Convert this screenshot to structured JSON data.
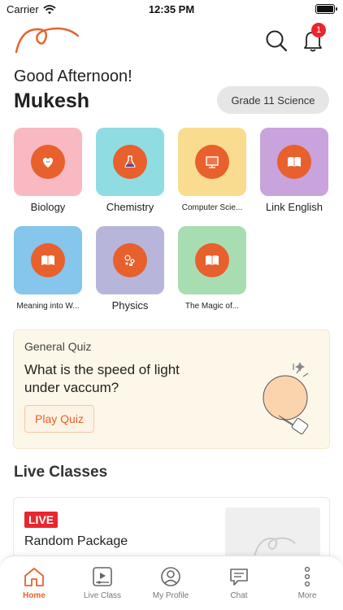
{
  "status_bar": {
    "carrier": "Carrier",
    "time": "12:35 PM"
  },
  "header": {
    "notification_count": "1"
  },
  "greeting": "Good Afternoon!",
  "user_name": "Mukesh",
  "grade": "Grade 11 Science",
  "subjects": [
    {
      "label": "Biology",
      "icon": "heart-icon",
      "color": "#f9b9c2"
    },
    {
      "label": "Chemistry",
      "icon": "flask-icon",
      "color": "#8fdde3"
    },
    {
      "label": "Computer Scie...",
      "icon": "monitor-icon",
      "color": "#f9dc8f"
    },
    {
      "label": "Link English",
      "icon": "book-icon",
      "color": "#c9a3dc"
    },
    {
      "label": "Meaning into W...",
      "icon": "book-icon",
      "color": "#86c5ec"
    },
    {
      "label": "Physics",
      "icon": "physics-icon",
      "color": "#b7b6da"
    },
    {
      "label": "The Magic of...",
      "icon": "book-icon",
      "color": "#a8dcb1"
    }
  ],
  "quiz": {
    "title": "General Quiz",
    "question": "What is the speed of light under vaccum?",
    "button": "Play Quiz"
  },
  "live_section": {
    "title": "Live Classes",
    "badge": "LIVE",
    "package_name": "Random Package"
  },
  "bottom_nav": [
    {
      "label": "Home",
      "icon": "home-icon",
      "active": true
    },
    {
      "label": "Live Class",
      "icon": "live-class-icon",
      "active": false
    },
    {
      "label": "My Profile",
      "icon": "profile-icon",
      "active": false
    },
    {
      "label": "Chat",
      "icon": "chat-icon",
      "active": false
    },
    {
      "label": "More",
      "icon": "more-icon",
      "active": false
    }
  ],
  "colors": {
    "accent": "#e8602c",
    "badge": "#e8262d"
  }
}
